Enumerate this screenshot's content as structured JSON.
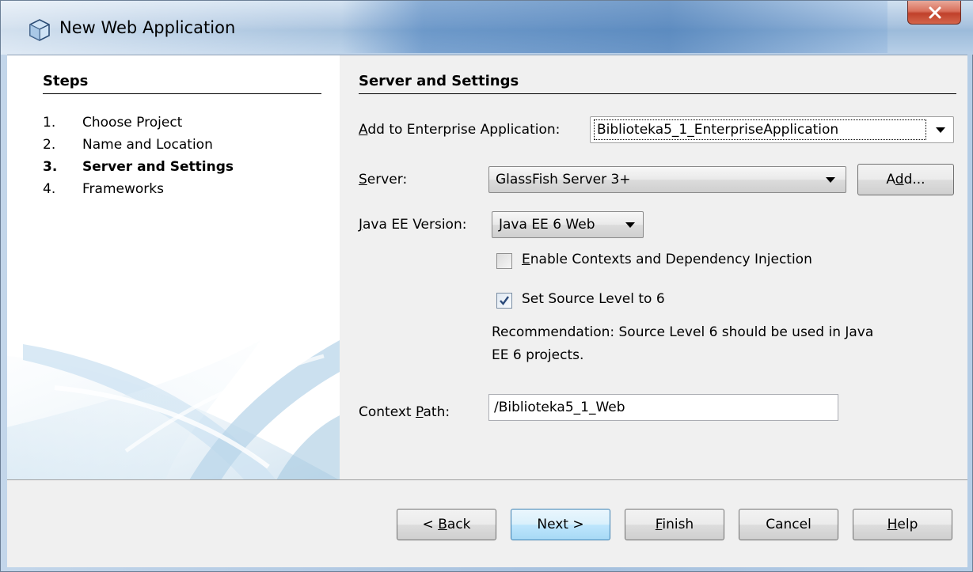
{
  "window": {
    "title": "New Web Application",
    "close_label": "X"
  },
  "steps": {
    "title": "Steps",
    "items": [
      {
        "num": "1.",
        "label": "Choose Project"
      },
      {
        "num": "2.",
        "label": "Name and Location"
      },
      {
        "num": "3.",
        "label": "Server and Settings"
      },
      {
        "num": "4.",
        "label": "Frameworks"
      }
    ],
    "current_step": 3
  },
  "settings": {
    "title": "Server and Settings",
    "enterprise_app": {
      "label_prefix": "A",
      "label_rest": "dd to Enterprise Application:",
      "value": "Biblioteka5_1_EnterpriseApplication"
    },
    "server": {
      "label_prefix": "S",
      "label_rest": "erver:",
      "value": "GlassFish Server 3+",
      "add_prefix": "A",
      "add_mnemonic": "d",
      "add_rest": "d..."
    },
    "java_ee": {
      "label_prefix": "J",
      "label_rest": "ava EE Version:",
      "value": "Java EE 6 Web"
    },
    "cdi": {
      "label_prefix": "E",
      "label_rest": "nable Contexts and Dependency Injection",
      "checked": false
    },
    "source_level": {
      "label": "Set Source Level to 6",
      "checked": true
    },
    "recommendation_line1": "Recommendation: Source Level 6 should be used in Java",
    "recommendation_line2": "EE 6 projects.",
    "context_path": {
      "label_pre": "Context ",
      "label_mnemonic": "P",
      "label_rest": "ath:",
      "value": "/Biblioteka5_1_Web"
    }
  },
  "buttons": {
    "back_pre": "< ",
    "back_mnemonic": "B",
    "back_rest": "ack",
    "next": "Next >",
    "finish_mnemonic": "F",
    "finish_rest": "inish",
    "cancel": "Cancel",
    "help_mnemonic": "H",
    "help_rest": "elp"
  }
}
